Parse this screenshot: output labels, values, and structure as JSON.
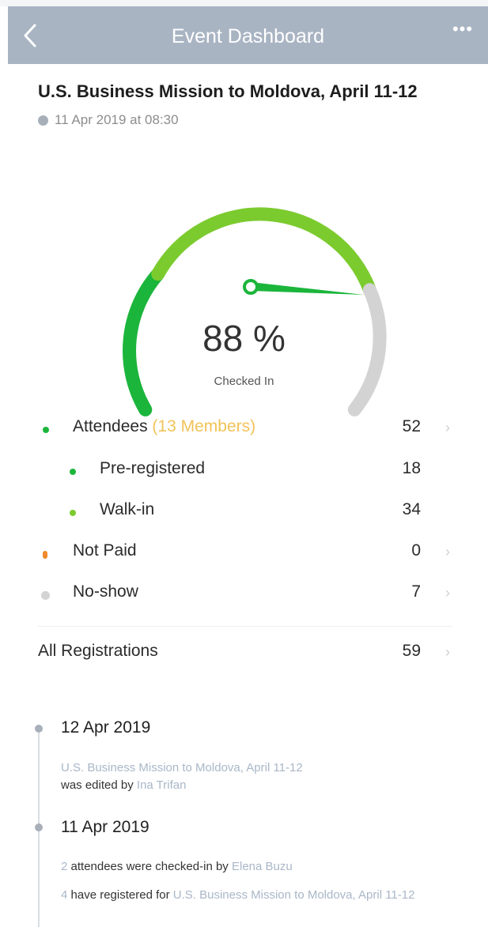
{
  "nav": {
    "title": "Event Dashboard"
  },
  "event": {
    "title": "U.S. Business Mission to Moldova, April 11-12",
    "datetime": "11 Apr 2019 at 08:30"
  },
  "gauge": {
    "percent_text": "88 %",
    "fraction": 0.88,
    "label": "Checked In"
  },
  "stats": {
    "attendees": {
      "label": "Attendees",
      "members": "(13 Members)",
      "value": "52"
    },
    "preregistered": {
      "label": "Pre-registered",
      "value": "18"
    },
    "walkin": {
      "label": "Walk-in",
      "value": "34"
    },
    "notpaid": {
      "label": "Not Paid",
      "value": "0"
    },
    "noshow": {
      "label": "No-show",
      "value": "7"
    },
    "all": {
      "label": "All Registrations",
      "value": "59"
    }
  },
  "colors": {
    "dark_green": "#1bb53b",
    "light_green": "#7bcb2f",
    "gray": "#d3d3d3",
    "orange": "#f08a2a",
    "nav": "#a9b4c3"
  },
  "timeline": [
    {
      "date": "12 Apr 2019",
      "entries": [
        {
          "link": "U.S. Business Mission to Moldova, April 11-12",
          "text": "was edited by",
          "person": "Ina Trifan"
        }
      ]
    },
    {
      "date": "11 Apr 2019",
      "entries": [
        {
          "count": "2",
          "text": "attendees were checked-in by",
          "person": "Elena Buzu"
        },
        {
          "count": "4",
          "text": "have registered for",
          "link": "U.S. Business Mission to Moldova, April 11-12"
        }
      ]
    }
  ]
}
